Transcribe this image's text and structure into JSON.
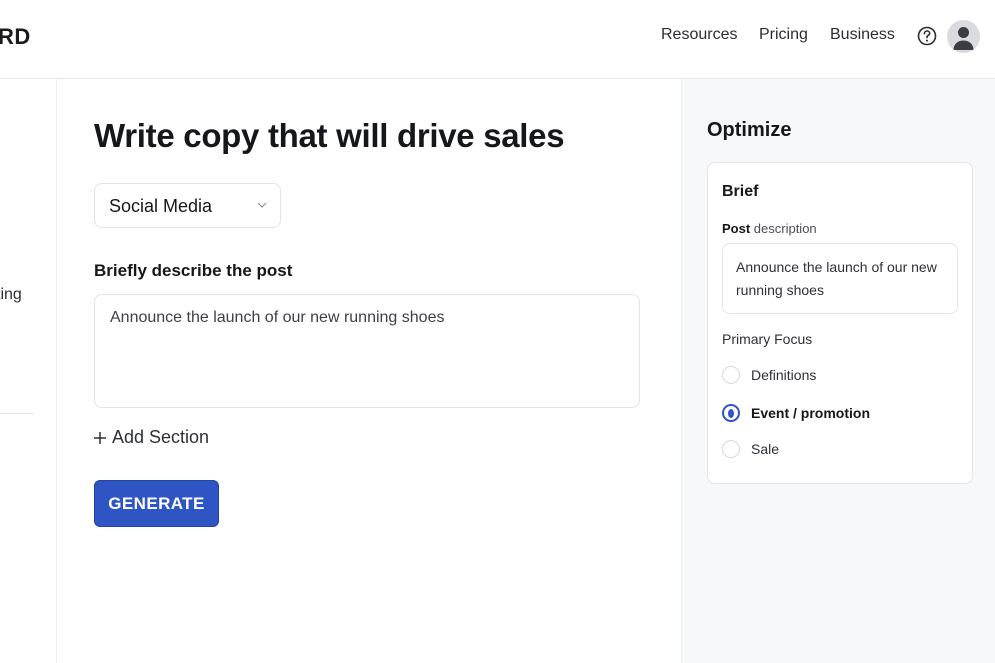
{
  "header": {
    "logo": "RD",
    "nav": [
      {
        "label": "Resources"
      },
      {
        "label": "Pricing"
      },
      {
        "label": "Business"
      }
    ],
    "help_icon": "help-circle-icon",
    "avatar_icon": "user-avatar-icon"
  },
  "left_rail": {
    "partial_text": "ting"
  },
  "main": {
    "title": "Write copy that will drive sales",
    "content_type": {
      "selected": "Social Media"
    },
    "describe_label": "Briefly describe the post",
    "describe_value": "Announce the launch of our new running shoes",
    "add_section_label": "Add Section",
    "generate_label": "GENERATE"
  },
  "optimize": {
    "title": "Optimize",
    "brief": {
      "title": "Brief",
      "label_strong": "Post",
      "label_rest": " description",
      "description_value": "Announce the launch of our new running shoes",
      "focus_label": "Primary Focus",
      "options": [
        {
          "label": "Definitions",
          "checked": false
        },
        {
          "label": "Event / promotion",
          "checked": true
        },
        {
          "label": "Sale",
          "checked": false
        }
      ]
    }
  },
  "colors": {
    "accent": "#2f54c4",
    "sidebar_bg": "#f7f8fa",
    "border": "#e2e4e8"
  }
}
